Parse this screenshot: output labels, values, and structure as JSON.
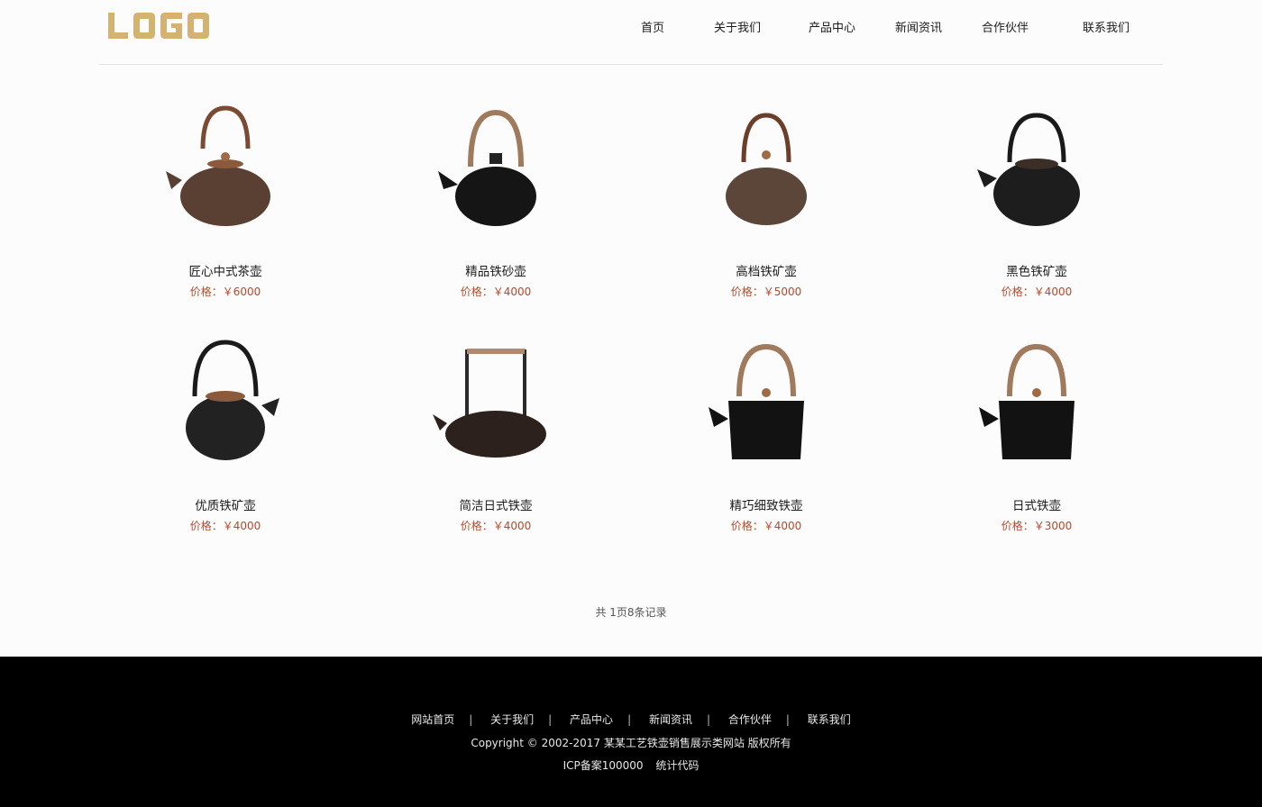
{
  "header": {
    "logo_text": "LOGO",
    "nav": [
      "首页",
      "关于我们",
      "产品中心",
      "新闻资讯",
      "合作伙伴",
      "联系我们"
    ]
  },
  "products": [
    {
      "name": "匠心中式茶壶",
      "price": "价格：￥6000",
      "color": "#5a4033"
    },
    {
      "name": "精品铁砂壶",
      "price": "价格：￥4000",
      "color": "#151515"
    },
    {
      "name": "高档铁矿壶",
      "price": "价格：￥5000",
      "color": "#5b4639"
    },
    {
      "name": "黑色铁矿壶",
      "price": "价格：￥4000",
      "color": "#1d1d1d"
    },
    {
      "name": "优质铁矿壶",
      "price": "价格：￥4000",
      "color": "#222222"
    },
    {
      "name": "简洁日式铁壶",
      "price": "价格：￥4000",
      "color": "#2d211d"
    },
    {
      "name": "精巧细致铁壶",
      "price": "价格：￥4000",
      "color": "#121212"
    },
    {
      "name": "日式铁壶",
      "price": "价格：￥3000",
      "color": "#121212"
    }
  ],
  "pagination": {
    "records_text": "共 1页8条记录"
  },
  "footer": {
    "nav": [
      "网站首页",
      "关于我们",
      "产品中心",
      "新闻资讯",
      "合作伙伴",
      "联系我们"
    ],
    "copyright": "Copyright © 2002-2017 某某工艺铁壶销售展示类网站 版权所有",
    "icp": "ICP备案100000",
    "stats": "统计代码"
  },
  "colors": {
    "logo": "#d2b371",
    "price": "#b8492a",
    "footer_bg": "#000000"
  }
}
